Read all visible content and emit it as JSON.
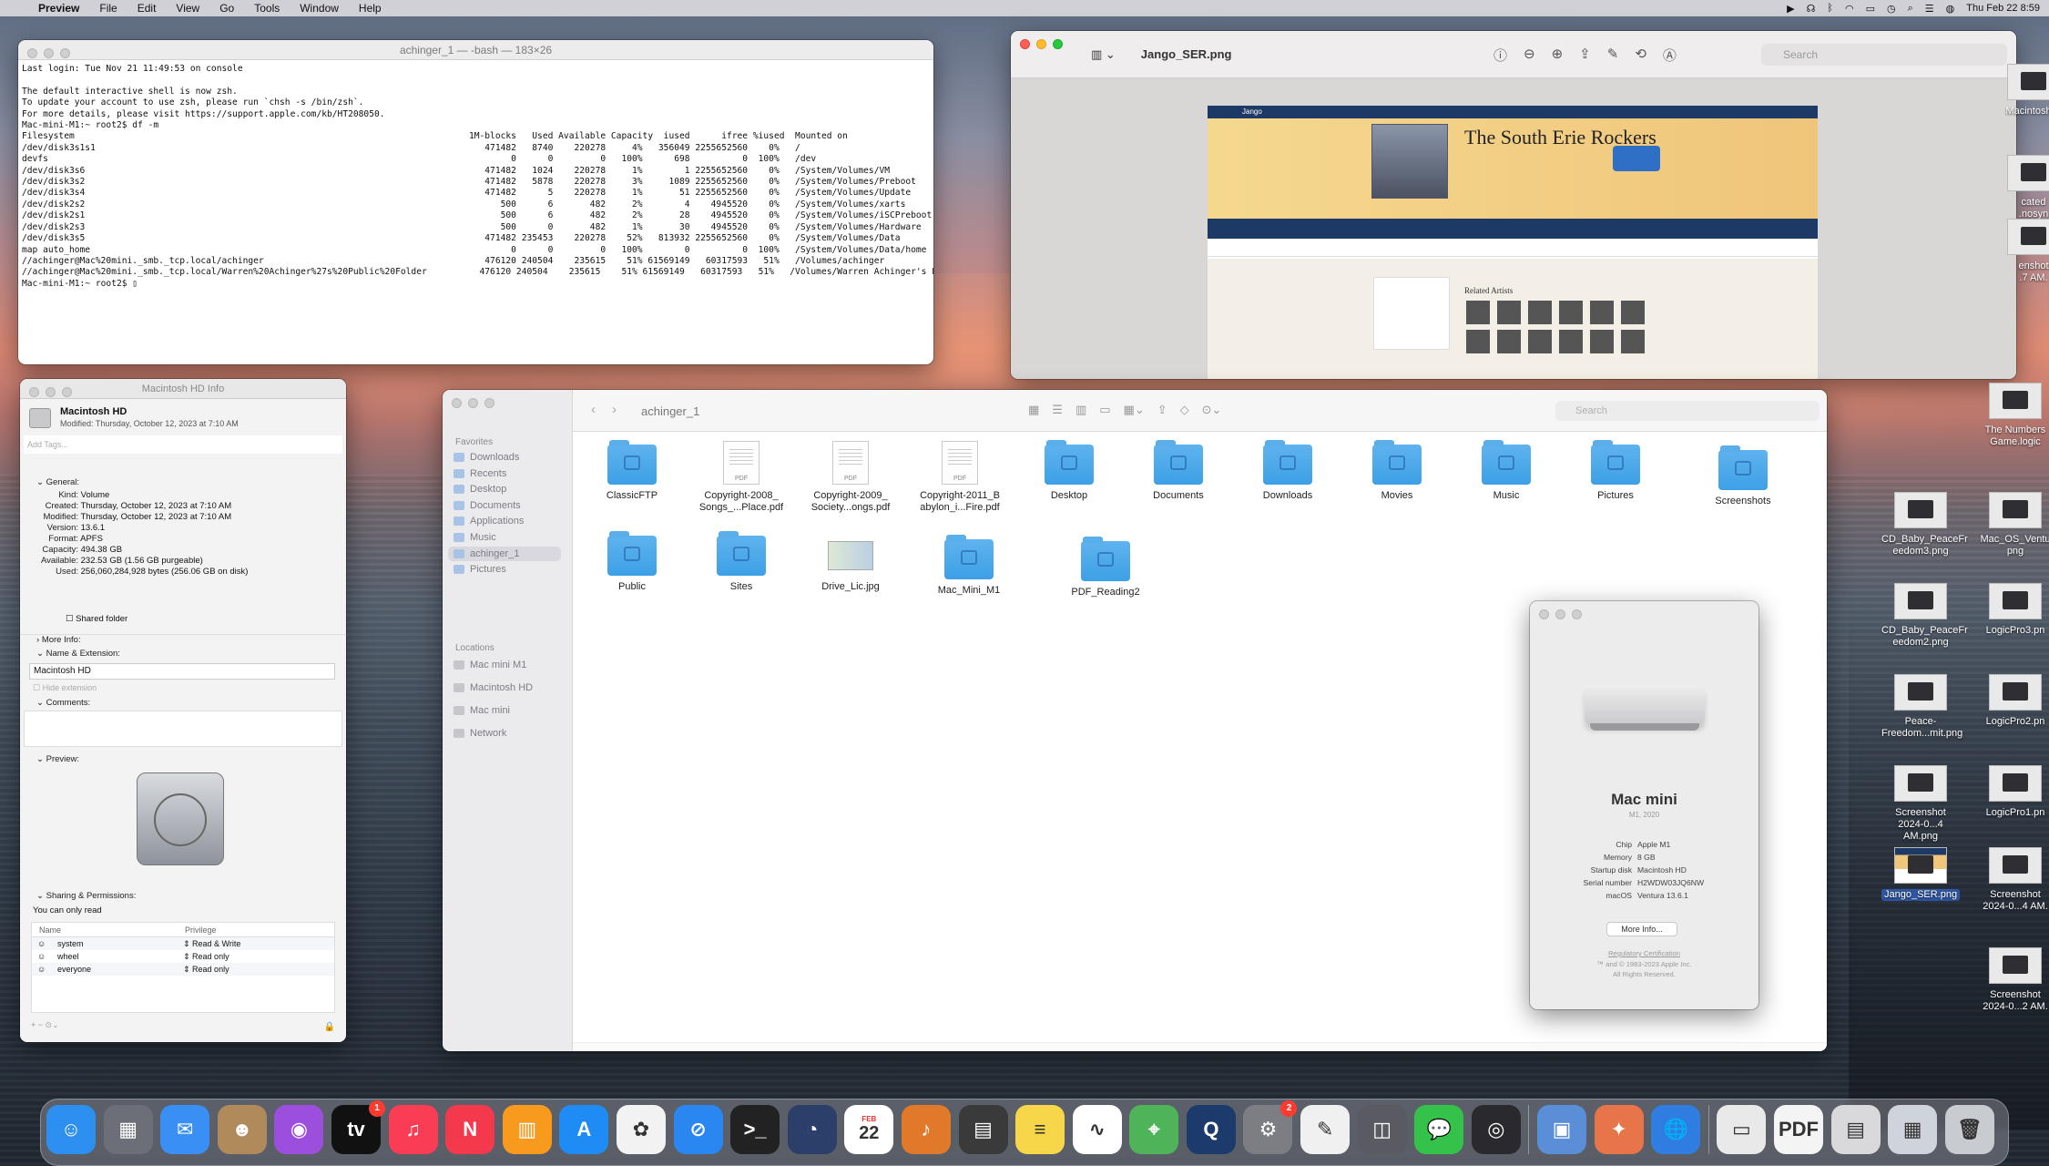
{
  "menubar": {
    "app": "Preview",
    "menus": [
      "File",
      "Edit",
      "View",
      "Go",
      "Tools",
      "Window",
      "Help"
    ],
    "clock": "Thu Feb 22  8:59"
  },
  "terminal": {
    "title": "achinger_1 — -bash — 183×26",
    "lines": [
      "Last login: Tue Nov 21 11:49:53 on console",
      "",
      "The default interactive shell is now zsh.",
      "To update your account to use zsh, please run `chsh -s /bin/zsh`.",
      "For more details, please visit https://support.apple.com/kb/HT208050.",
      "Mac-mini-M1:~ root2$ df -m",
      "Filesystem                                                                           1M-blocks   Used Available Capacity  iused      ifree %iused  Mounted on",
      "/dev/disk3s1s1                                                                          471482   8740    220278     4%   356049 2255652560    0%   /",
      "devfs                                                                                        0      0         0   100%      698          0  100%   /dev",
      "/dev/disk3s6                                                                            471482   1024    220278     1%        1 2255652560    0%   /System/Volumes/VM",
      "/dev/disk3s2                                                                            471482   5878    220278     3%     1089 2255652560    0%   /System/Volumes/Preboot",
      "/dev/disk3s4                                                                            471482      5    220278     1%       51 2255652560    0%   /System/Volumes/Update",
      "/dev/disk2s2                                                                               500      6       482     2%        4    4945520    0%   /System/Volumes/xarts",
      "/dev/disk2s1                                                                               500      6       482     2%       28    4945520    0%   /System/Volumes/iSCPreboot",
      "/dev/disk2s3                                                                               500      0       482     1%       30    4945520    0%   /System/Volumes/Hardware",
      "/dev/disk3s5                                                                            471482 235453    220278    52%   813932 2255652560    0%   /System/Volumes/Data",
      "map auto_home                                                                                0      0         0   100%        0          0  100%   /System/Volumes/Data/home",
      "//achinger@Mac%20mini._smb._tcp.local/achinger                                          476120 240504    235615    51% 61569149   60317593   51%   /Volumes/achinger",
      "//achinger@Mac%20mini._smb._tcp.local/Warren%20Achinger%27s%20Public%20Folder          476120 240504    235615    51% 61569149   60317593   51%   /Volumes/Warren Achinger's Public Folder",
      "Mac-mini-M1:~ root2$ ▯"
    ]
  },
  "preview": {
    "title": "Jango_SER.png",
    "search_placeholder": "Search",
    "doc": {
      "brand": "Jango",
      "heading": "The South Erie Rockers",
      "related": "Related Artists"
    }
  },
  "info": {
    "title": "Macintosh HD Info",
    "name": "Macintosh HD",
    "modified": "Modified: Thursday, October 12, 2023 at 7:10 AM",
    "tags_placeholder": "Add Tags...",
    "general_label": "General:",
    "general": [
      {
        "k": "Kind:",
        "v": "Volume"
      },
      {
        "k": "Created:",
        "v": "Thursday, October 12, 2023 at 7:10 AM"
      },
      {
        "k": "Modified:",
        "v": "Thursday, October 12, 2023 at 7:10 AM"
      },
      {
        "k": "Version:",
        "v": "13.6.1"
      },
      {
        "k": "Format:",
        "v": "APFS"
      },
      {
        "k": "Capacity:",
        "v": "494.38 GB"
      },
      {
        "k": "Available:",
        "v": "232.53 GB (1.56 GB purgeable)"
      },
      {
        "k": "Used:",
        "v": "256,060,284,928 bytes (256.06 GB on disk)"
      }
    ],
    "shared_folder": "Shared folder",
    "more_info": "More Info:",
    "name_ext": "Name & Extension:",
    "name_value": "Macintosh HD",
    "hide_ext": "Hide extension",
    "comments": "Comments:",
    "preview": "Preview:",
    "sharing": "Sharing & Permissions:",
    "read_only": "You can only read",
    "col_name": "Name",
    "col_priv": "Privilege",
    "perms": [
      {
        "name": "system",
        "priv": "Read & Write"
      },
      {
        "name": "wheel",
        "priv": "Read only"
      },
      {
        "name": "everyone",
        "priv": "Read only"
      }
    ]
  },
  "finder": {
    "title": "achinger_1",
    "search_placeholder": "Search",
    "favorites_label": "Favorites",
    "favorites": [
      "Downloads",
      "Recents",
      "Desktop",
      "Documents",
      "Applications",
      "Music",
      "achinger_1",
      "Pictures"
    ],
    "locations_label": "Locations",
    "locations": [
      "Mac mini M1",
      "Macintosh HD",
      "Mac mini",
      "Network"
    ],
    "items": [
      {
        "label": "ClassicFTP",
        "kind": "folder"
      },
      {
        "label": "Copyright-2008_\nSongs_...Place.pdf",
        "kind": "pdf"
      },
      {
        "label": "Copyright-2009_\nSociety...ongs.pdf",
        "kind": "pdf"
      },
      {
        "label": "Copyright-2011_B\nabylon_i...Fire.pdf",
        "kind": "pdf"
      },
      {
        "label": "Desktop",
        "kind": "folder"
      },
      {
        "label": "Documents",
        "kind": "folder"
      },
      {
        "label": "Downloads",
        "kind": "folder"
      },
      {
        "label": "Movies",
        "kind": "folder"
      },
      {
        "label": "Music",
        "kind": "folder"
      },
      {
        "label": "Pictures",
        "kind": "folder"
      },
      {
        "label": "Screenshots",
        "kind": "folder"
      },
      {
        "label": "Public",
        "kind": "folder"
      },
      {
        "label": "Sites",
        "kind": "folder"
      },
      {
        "label": "Drive_Lic.jpg",
        "kind": "image"
      },
      {
        "label": "Mac_Mini_M1",
        "kind": "folder"
      },
      {
        "label": "PDF_Reading2",
        "kind": "folder"
      }
    ]
  },
  "about": {
    "name": "Mac mini",
    "sub": "M1, 2020",
    "specs": [
      {
        "k": "Chip",
        "v": "Apple M1"
      },
      {
        "k": "Memory",
        "v": "8 GB"
      },
      {
        "k": "Startup disk",
        "v": "Macintosh HD"
      },
      {
        "k": "Serial number",
        "v": "H2WDW03JQ6NW"
      },
      {
        "k": "macOS",
        "v": "Ventura 13.6.1"
      }
    ],
    "more": "More Info...",
    "reg": "Regulatory Certification",
    "copy1": "™ and © 1983-2023 Apple Inc.",
    "copy2": "All Rights Reserved."
  },
  "desktop": {
    "icons": [
      {
        "label": "Macintosh H"
      },
      {
        "label": "cated\n.nosyn"
      },
      {
        "label": "enshot\n.7 AM.",
        "kind": "thumb"
      },
      {
        "label": "The Numbers\nGame.logic"
      },
      {
        "label": "CD_Baby_PeaceFr\needom3.png"
      },
      {
        "label": "Mac_OS_Ventu\npng"
      },
      {
        "label": "CD_Baby_PeaceFr\needom2.png"
      },
      {
        "label": "LogicPro3.pn"
      },
      {
        "label": "Peace-\nFreedom...mit.png"
      },
      {
        "label": "LogicPro2.pn"
      },
      {
        "label": "Screenshot\n2024-0...4 AM.png"
      },
      {
        "label": "LogicPro1.pn"
      },
      {
        "label": "Jango_SER.png"
      },
      {
        "label": "Screenshot\n2024-0...4 AM."
      },
      {
        "label": "Screenshot\n2024-0...2 AM."
      }
    ]
  },
  "dock": {
    "apps": [
      {
        "name": "Finder",
        "color": "#2d8ff0",
        "glyph": "☺"
      },
      {
        "name": "Launchpad",
        "color": "#6c6f78",
        "glyph": "▦"
      },
      {
        "name": "Mail",
        "color": "#3a8ff5",
        "glyph": "✉"
      },
      {
        "name": "Contacts",
        "color": "#b08a5a",
        "glyph": "☻"
      },
      {
        "name": "Podcasts",
        "color": "#9b4fdc",
        "glyph": "◉"
      },
      {
        "name": "TV",
        "color": "#111111",
        "glyph": "tv",
        "badge": "1"
      },
      {
        "name": "Music",
        "color": "#fa3d55",
        "glyph": "♫"
      },
      {
        "name": "News",
        "color": "#f4394d",
        "glyph": "N"
      },
      {
        "name": "Books",
        "color": "#f79a1e",
        "glyph": "▥"
      },
      {
        "name": "App Store",
        "color": "#1f8cf5",
        "glyph": "A"
      },
      {
        "name": "Photos",
        "color": "#f2f2f2",
        "glyph": "✿"
      },
      {
        "name": "Safari",
        "color": "#2a86f0",
        "glyph": "⊘"
      },
      {
        "name": "Terminal",
        "color": "#222222",
        "glyph": ">_"
      },
      {
        "name": "Clock",
        "color": "#2c3e6a",
        "glyph": "◔"
      },
      {
        "name": "Calendar",
        "color": "#ffffff",
        "glyph": "22",
        "sub": "FEB"
      },
      {
        "name": "GarageBand",
        "color": "#e07a2a",
        "glyph": "♪"
      },
      {
        "name": "Calculator",
        "color": "#3a3a3a",
        "glyph": "▤"
      },
      {
        "name": "Notes",
        "color": "#f7d64a",
        "glyph": "≡"
      },
      {
        "name": "Freeform",
        "color": "#ffffff",
        "glyph": "∿"
      },
      {
        "name": "Maps",
        "color": "#4fb35a",
        "glyph": "⌖"
      },
      {
        "name": "QuickTime",
        "color": "#1c3a6b",
        "glyph": "Q"
      },
      {
        "name": "System Settings",
        "color": "#7d7d84",
        "glyph": "⚙",
        "badge": "2"
      },
      {
        "name": "TextEdit",
        "color": "#f0f0f0",
        "glyph": "✎"
      },
      {
        "name": "Screenshot",
        "color": "#5a5a62",
        "glyph": "◫"
      },
      {
        "name": "Messages",
        "color": "#35c24a",
        "glyph": "💬"
      },
      {
        "name": "Logic Pro",
        "color": "#2a2a2e",
        "glyph": "◎"
      },
      {
        "name": "Preview",
        "color": "#5a8fd8",
        "glyph": "▣"
      },
      {
        "name": "Pixelmator",
        "color": "#e8744a",
        "glyph": "✦"
      },
      {
        "name": "Network",
        "color": "#2f7de0",
        "glyph": "🌐"
      },
      {
        "name": "Files",
        "color": "#e9e9ea",
        "glyph": "▭"
      },
      {
        "name": "PDF",
        "color": "#f4f4f4",
        "glyph": "PDF"
      },
      {
        "name": "Documents Stack",
        "color": "#d9d9dc",
        "glyph": "▤"
      },
      {
        "name": "Pictures Stack",
        "color": "#cfd4dc",
        "glyph": "▦"
      },
      {
        "name": "Trash",
        "color": "#c8cbd0",
        "glyph": "🗑"
      }
    ]
  }
}
